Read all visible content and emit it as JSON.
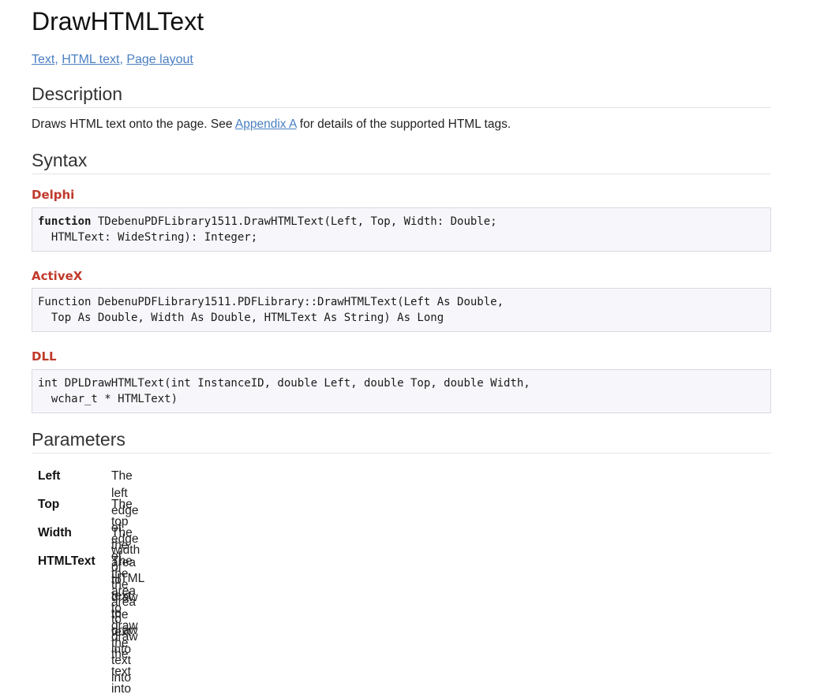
{
  "title": "DrawHTMLText",
  "related_links": [
    "Text",
    "HTML text",
    "Page layout"
  ],
  "related_separator": ", ",
  "description": {
    "heading": "Description",
    "text_before": "Draws HTML text onto the page. See ",
    "link": "Appendix A",
    "text_after": " for details of the supported HTML tags."
  },
  "syntax": {
    "heading": "Syntax",
    "delphi": {
      "label": "Delphi",
      "keyword": "function",
      "line1_rest": " TDebenuPDFLibrary1511.DrawHTMLText(Left, Top, Width: Double;",
      "line2": "  HTMLText: WideString): Integer;"
    },
    "activex": {
      "label": "ActiveX",
      "line1": "Function DebenuPDFLibrary1511.PDFLibrary::DrawHTMLText(Left As Double,",
      "line2": "  Top As Double, Width As Double, HTMLText As String) As Long"
    },
    "dll": {
      "label": "DLL",
      "line1": "int DPLDrawHTMLText(int InstanceID, double Left, double Top, double Width,",
      "line2": "  wchar_t * HTMLText)"
    }
  },
  "parameters": {
    "heading": "Parameters",
    "items": [
      {
        "name": "Left",
        "description": "The left edge of the area to draw the text into"
      },
      {
        "name": "Top",
        "description": "The top edge of the area to draw the text into"
      },
      {
        "name": "Width",
        "description": "The width of the area to draw the text into"
      },
      {
        "name": "HTMLText",
        "description": "The HTML text to draw"
      }
    ]
  }
}
